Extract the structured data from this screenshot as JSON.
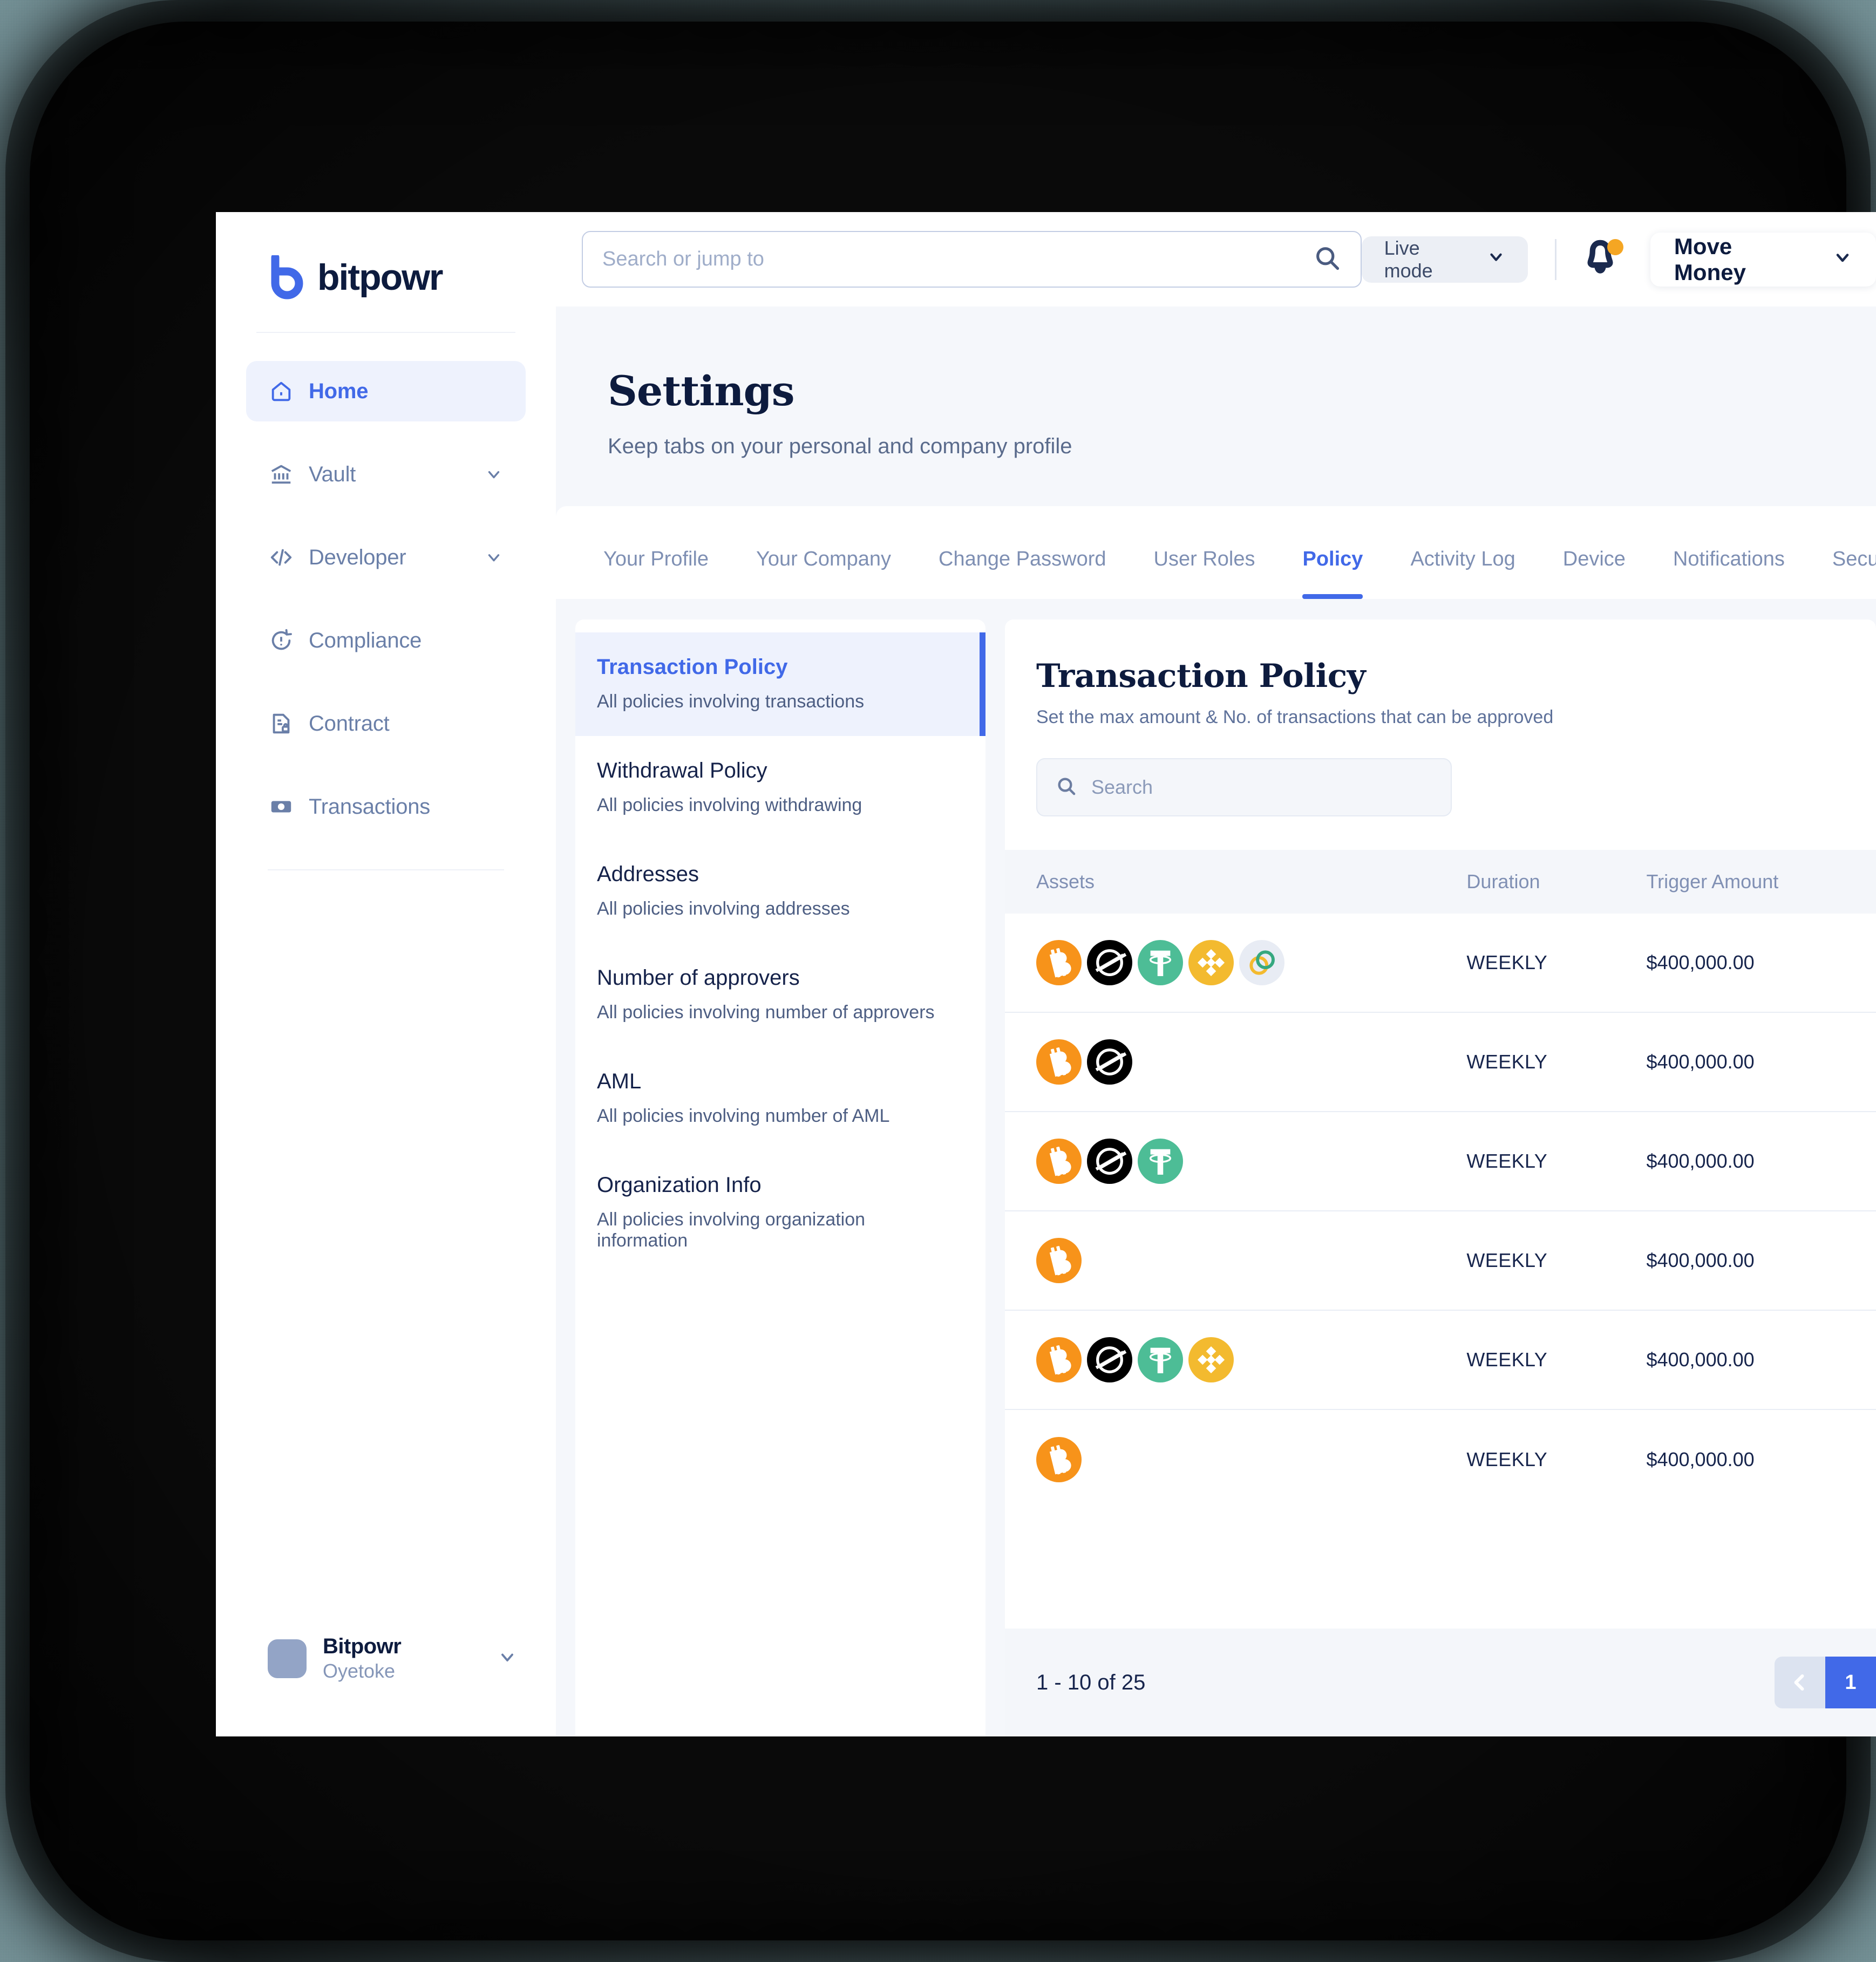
{
  "brand": {
    "name": "bitpowr",
    "accent": "#4169e8",
    "dark": "#0d1b3e"
  },
  "sidebar": {
    "items": [
      {
        "label": "Home",
        "icon": "home-icon",
        "active": true,
        "chevron": false
      },
      {
        "label": "Vault",
        "icon": "bank-icon",
        "active": false,
        "chevron": true
      },
      {
        "label": "Developer",
        "icon": "code-icon",
        "active": false,
        "chevron": true
      },
      {
        "label": "Compliance",
        "icon": "alert-refresh-icon",
        "active": false,
        "chevron": false
      },
      {
        "label": "Contract",
        "icon": "document-lock-icon",
        "active": false,
        "chevron": false
      },
      {
        "label": "Transactions",
        "icon": "banknote-icon",
        "active": false,
        "chevron": false
      }
    ],
    "footer": {
      "org": "Bitpowr",
      "user": "Oyetoke"
    }
  },
  "topbar": {
    "search_placeholder": "Search or jump to",
    "live_mode_label": "Live mode",
    "move_money_label": "Move Money",
    "notification_badge": true
  },
  "page": {
    "title": "Settings",
    "subtitle": "Keep tabs on your personal and company profile"
  },
  "tabs": [
    {
      "label": "Your Profile",
      "active": false
    },
    {
      "label": "Your Company",
      "active": false
    },
    {
      "label": "Change Password",
      "active": false
    },
    {
      "label": "User Roles",
      "active": false
    },
    {
      "label": "Policy",
      "active": true
    },
    {
      "label": "Activity Log",
      "active": false
    },
    {
      "label": "Device",
      "active": false
    },
    {
      "label": "Notifications",
      "active": false
    },
    {
      "label": "Security",
      "active": false
    }
  ],
  "policy_list": [
    {
      "name": "Transaction Policy",
      "desc": "All policies involving transactions",
      "active": true
    },
    {
      "name": "Withdrawal Policy",
      "desc": "All policies involving withdrawing",
      "active": false
    },
    {
      "name": "Addresses",
      "desc": "All policies involving addresses",
      "active": false
    },
    {
      "name": "Number of approvers",
      "desc": "All policies involving number of approvers",
      "active": false
    },
    {
      "name": "AML",
      "desc": "All policies involving number of AML",
      "active": false
    },
    {
      "name": "Organization Info",
      "desc": "All policies involving organization information",
      "active": false
    }
  ],
  "detail": {
    "title": "Transaction Policy",
    "subtitle": "Set the max amount & No. of transactions that can be approved",
    "search_placeholder": "Search",
    "columns": {
      "assets": "Assets",
      "duration": "Duration",
      "trigger": "Trigger Amount"
    },
    "rows": [
      {
        "assets": [
          "bitcoin",
          "stellar",
          "tether",
          "binance",
          "celo"
        ],
        "duration": "WEEKLY",
        "trigger": "$400,000.00"
      },
      {
        "assets": [
          "bitcoin",
          "stellar"
        ],
        "duration": "WEEKLY",
        "trigger": "$400,000.00"
      },
      {
        "assets": [
          "bitcoin",
          "stellar",
          "tether"
        ],
        "duration": "WEEKLY",
        "trigger": "$400,000.00"
      },
      {
        "assets": [
          "bitcoin"
        ],
        "duration": "WEEKLY",
        "trigger": "$400,000.00"
      },
      {
        "assets": [
          "bitcoin",
          "stellar",
          "tether",
          "binance"
        ],
        "duration": "WEEKLY",
        "trigger": "$400,000.00"
      },
      {
        "assets": [
          "bitcoin"
        ],
        "duration": "WEEKLY",
        "trigger": "$400,000.00"
      }
    ],
    "pagination": {
      "count_label": "1 - 10 of 25",
      "current_page": "1"
    }
  },
  "asset_colors": {
    "bitcoin": "#f7931a",
    "stellar": "#000000",
    "tether": "#4dbd96",
    "binance": "#f3ba2f",
    "celo": "#e8ecf4"
  }
}
